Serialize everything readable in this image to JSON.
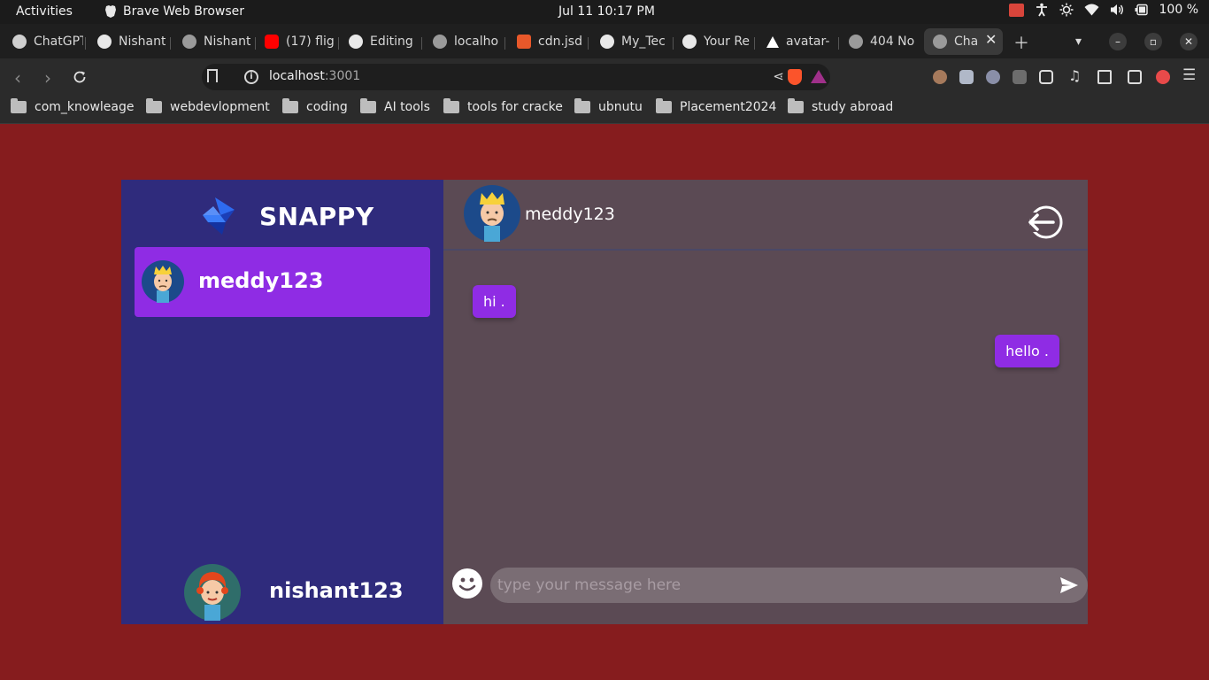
{
  "system_bar": {
    "activities": "Activities",
    "app_name": "Brave Web Browser",
    "clock": "Jul 11  10:17 PM",
    "battery": "100 %"
  },
  "tabs": [
    {
      "label": "ChatGPT",
      "icon": "chatgpt-icon"
    },
    {
      "label": "Nishant",
      "icon": "github-icon"
    },
    {
      "label": "Nishant",
      "icon": "globe-icon"
    },
    {
      "label": "(17) flig",
      "icon": "youtube-icon"
    },
    {
      "label": "Editing",
      "icon": "github-icon"
    },
    {
      "label": "localho",
      "icon": "globe-icon"
    },
    {
      "label": "cdn.jsd",
      "icon": "shield-icon"
    },
    {
      "label": "My_Tec",
      "icon": "github-icon"
    },
    {
      "label": "Your Re",
      "icon": "github-icon"
    },
    {
      "label": "avatar-",
      "icon": "triangle-icon"
    },
    {
      "label": "404 No",
      "icon": "globe-icon"
    },
    {
      "label": "Cha",
      "icon": "globe-icon",
      "active": true
    }
  ],
  "toolbar": {
    "url_host": "localhost",
    "url_port": ":3001"
  },
  "bookmarks": [
    "com_knowleage",
    "webdevlopment",
    "coding",
    "AI tools",
    "tools for cracke",
    "ubnutu",
    "Placement2024",
    "study abroad"
  ],
  "app": {
    "brand": "SNAPPY",
    "contacts": [
      {
        "name": "meddy123",
        "selected": true
      }
    ],
    "current_user": "nishant123",
    "chat": {
      "with": "meddy123",
      "messages": [
        {
          "text": "hi .",
          "direction": "received"
        },
        {
          "text": "hello .",
          "direction": "sent"
        }
      ],
      "input_placeholder": "type your message here",
      "input_value": ""
    },
    "colors": {
      "background": "#861c1e",
      "sidebar": "#2f2b7c",
      "chat_panel": "#5b4a54",
      "accent": "#8f2ce4"
    }
  }
}
